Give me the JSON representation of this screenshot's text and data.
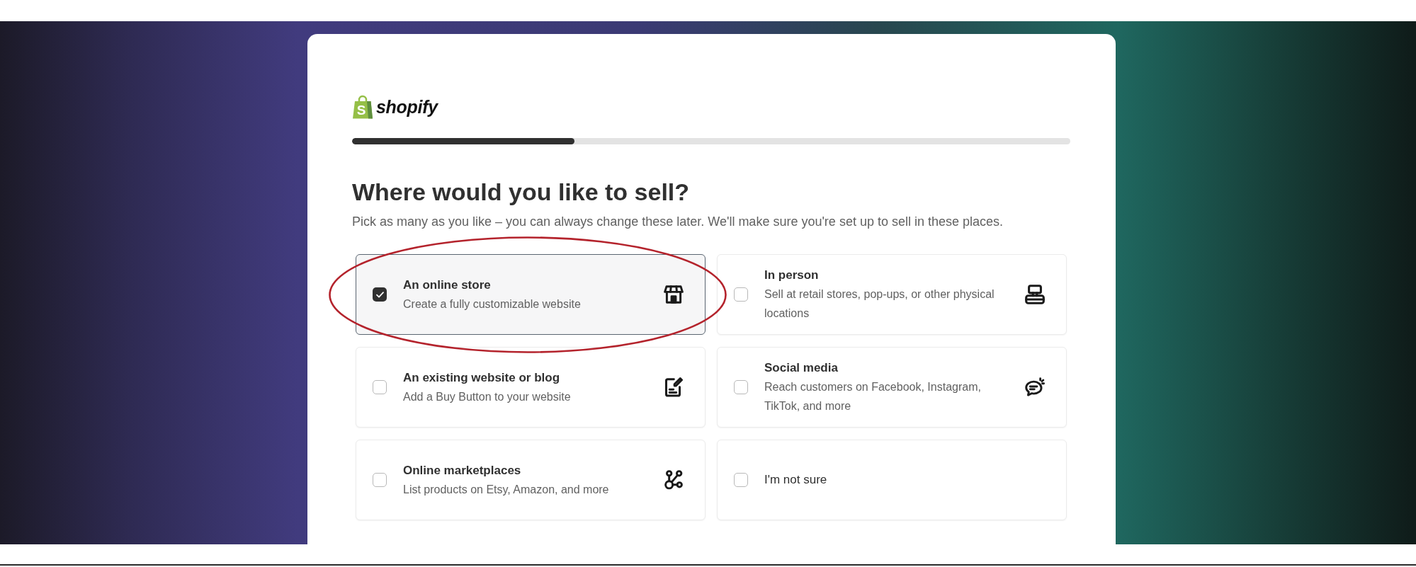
{
  "logo": {
    "badge_letter": "S",
    "wordmark": "shopify"
  },
  "progress": {
    "level": 0.31
  },
  "heading": "Where would you like to sell?",
  "subtitle": "Pick as many as you like – you can always change these later. We'll make sure you're set up to sell in these places.",
  "options": [
    {
      "kind": "channel",
      "title": "An online store",
      "description": "Create a fully customizable website",
      "checked": true,
      "circled": true
    },
    {
      "kind": "channel",
      "title": "In person",
      "description": "Sell at retail stores, pop-ups, or other physical locations",
      "checked": false,
      "circled": false
    },
    {
      "kind": "channel",
      "title": "An existing website or blog",
      "description": "Add a Buy Button to your website",
      "checked": false,
      "circled": false
    },
    {
      "kind": "channel",
      "title": "Social media",
      "description": "Reach customers on Facebook, Instagram, TikTok, and more",
      "checked": false,
      "circled": false
    },
    {
      "kind": "channel",
      "title": "Online marketplaces",
      "description": "List products on Etsy, Amazon, and more",
      "checked": false,
      "circled": false
    },
    {
      "kind": "unsure",
      "title": "I'm not sure",
      "checked": false,
      "circled": false
    }
  ]
}
